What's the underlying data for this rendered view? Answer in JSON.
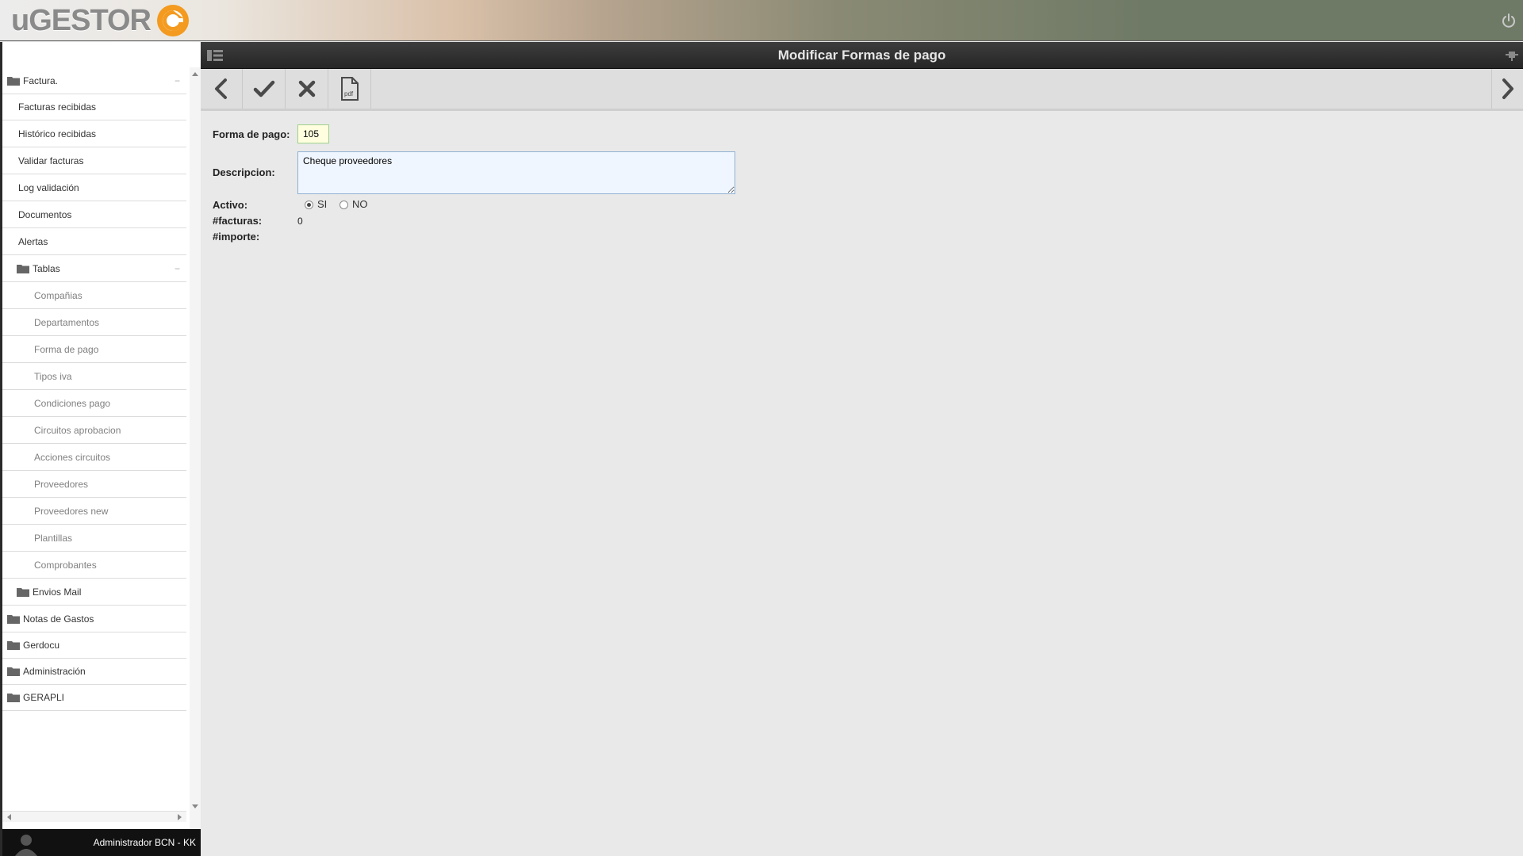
{
  "header": {
    "logo_text": "uGESTOR"
  },
  "sidebar": {
    "items": [
      {
        "label": "Factura.",
        "type": "group",
        "collapse": "−"
      },
      {
        "label": "Facturas recibidas",
        "type": "item"
      },
      {
        "label": "Histórico recibidas",
        "type": "item"
      },
      {
        "label": "Validar facturas",
        "type": "item"
      },
      {
        "label": "Log validación",
        "type": "item"
      },
      {
        "label": "Documentos",
        "type": "item"
      },
      {
        "label": "Alertas",
        "type": "item"
      },
      {
        "label": "Tablas",
        "type": "subgroup",
        "collapse": "−"
      },
      {
        "label": "Compañias",
        "type": "subitem"
      },
      {
        "label": "Departamentos",
        "type": "subitem"
      },
      {
        "label": "Forma de pago",
        "type": "subitem"
      },
      {
        "label": "Tipos iva",
        "type": "subitem"
      },
      {
        "label": "Condiciones pago",
        "type": "subitem"
      },
      {
        "label": "Circuitos aprobacion",
        "type": "subitem"
      },
      {
        "label": "Acciones circuitos",
        "type": "subitem"
      },
      {
        "label": "Proveedores",
        "type": "subitem"
      },
      {
        "label": "Proveedores new",
        "type": "subitem"
      },
      {
        "label": "Plantillas",
        "type": "subitem"
      },
      {
        "label": "Comprobantes",
        "type": "subitem"
      },
      {
        "label": "Envios Mail",
        "type": "subgroup"
      },
      {
        "label": "Notas de Gastos",
        "type": "group"
      },
      {
        "label": "Gerdocu",
        "type": "group"
      },
      {
        "label": "Administración",
        "type": "group"
      },
      {
        "label": "GERAPLI",
        "type": "group"
      }
    ],
    "user_name": "Administrador BCN - KK"
  },
  "main": {
    "title": "Modificar Formas de pago",
    "toolbar": {
      "back_icon": "chevron-left-icon",
      "save_icon": "check-icon",
      "cancel_icon": "close-icon",
      "pdf_icon": "pdf-icon",
      "pdf_label": "pdf",
      "next_icon": "chevron-right-icon"
    },
    "form": {
      "codigo_label": "Forma de pago:",
      "codigo_value": "105",
      "descripcion_label": "Descripcion:",
      "descripcion_value": "Cheque proveedores",
      "activo_label": "Activo:",
      "activo_si": "SI",
      "activo_no": "NO",
      "activo_selected": "SI",
      "facturas_label": "#facturas:",
      "facturas_value": "0",
      "importe_label": "#importe:"
    }
  },
  "colors": {
    "logo_orange": "#f39a1f",
    "titlebar": "#2f2f2f",
    "toolbar": "#dedede",
    "input_highlight": "#ffffe0"
  }
}
